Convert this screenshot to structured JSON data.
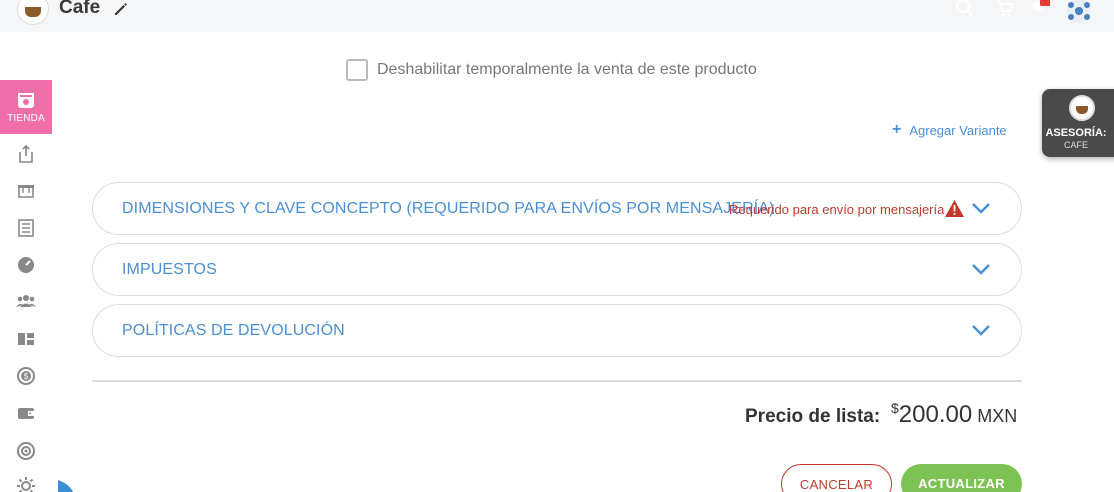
{
  "header": {
    "store_name": "Cafe",
    "logo_text": "Coffee Shop",
    "icons": [
      "search-icon",
      "cart-icon",
      "notification-icon",
      "user-avatar"
    ]
  },
  "sidebar": {
    "active_label": "TIENDA",
    "items": [
      "share-icon",
      "store-icon",
      "list-icon",
      "speedometer-icon",
      "users-icon",
      "dashboard-icon",
      "coin-icon",
      "wallet-icon",
      "target-icon",
      "settings-icon"
    ]
  },
  "form": {
    "disable_sale_label": "Deshabilitar temporalmente la venta de este producto",
    "disable_sale_checked": false,
    "add_variant_label": "Agregar Variante"
  },
  "asesoria": {
    "title": "ASESORÍA:",
    "subtitle": "CAFE"
  },
  "sections": [
    {
      "title": "DIMENSIONES Y CLAVE CONCEPTO (REQUERIDO PARA ENVÍOS POR MENSAJERÍA)",
      "warning": "Requerido para envío por mensajería"
    },
    {
      "title": "IMPUESTOS"
    },
    {
      "title": "POLÍTICAS DE DEVOLUCIÓN"
    }
  ],
  "price": {
    "label": "Precio de lista:",
    "currency_symbol": "$",
    "amount": "200.00",
    "currency_code": "MXN"
  },
  "actions": {
    "cancel_label": "CANCELAR",
    "update_label": "ACTUALIZAR"
  },
  "colors": {
    "accent_blue": "#4a8fd6",
    "active_pink": "#f06fa8",
    "warning_red": "#c0392b",
    "update_green": "#7cc353"
  }
}
